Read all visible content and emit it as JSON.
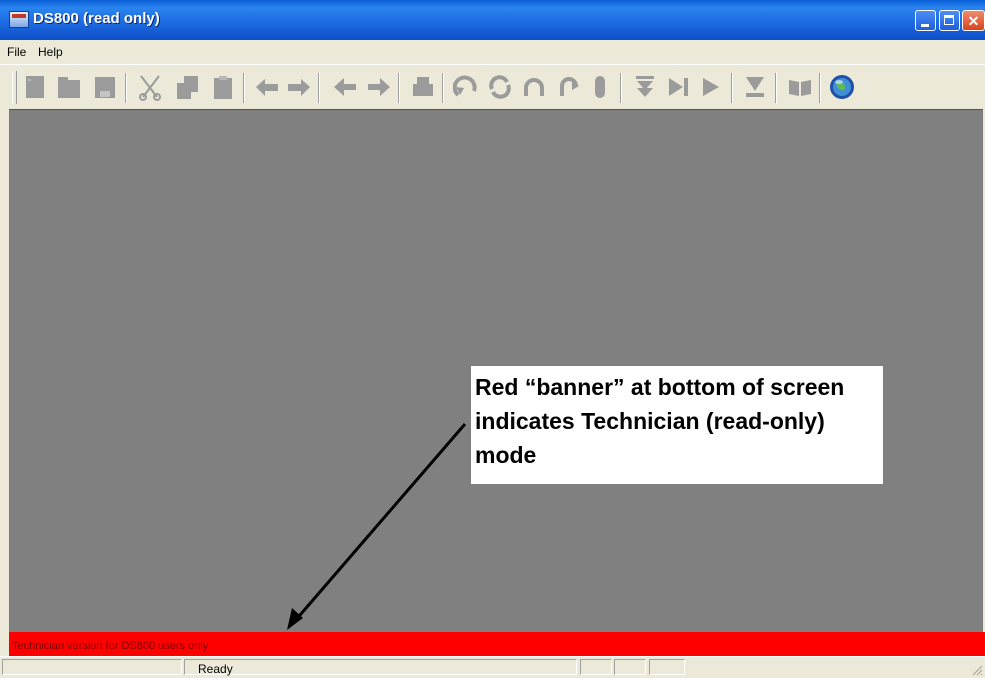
{
  "window": {
    "title": "DS800 (read only)",
    "icons": [
      "app-icon",
      "minimize-icon",
      "maximize-icon",
      "close-icon"
    ]
  },
  "menu": {
    "items": [
      {
        "label": "File"
      },
      {
        "label": "Help"
      }
    ]
  },
  "toolbar": {
    "icons": [
      "new-icon",
      "open-icon",
      "save-icon",
      "cut-icon",
      "copy-icon",
      "paste-icon",
      "undo-icon",
      "redo-icon",
      "back-icon",
      "forward-icon",
      "print-icon",
      "rotate-left-icon",
      "refresh-icon",
      "rotate-up-icon",
      "rotate-right-icon",
      "capsule-icon",
      "download-icon",
      "step-forward-icon",
      "play-icon",
      "stop-icon",
      "book-icon",
      "globe-icon"
    ]
  },
  "banner": {
    "text": "Technician version for DS800 users only",
    "color": "#ff0000"
  },
  "status": {
    "text": "Ready"
  },
  "callout": {
    "text": "Red “banner” at bottom of screen indicates Technician (read-only) mode"
  },
  "colors": {
    "titlebar": "#0a5fd8",
    "client": "#808080",
    "banner": "#ff0000"
  }
}
